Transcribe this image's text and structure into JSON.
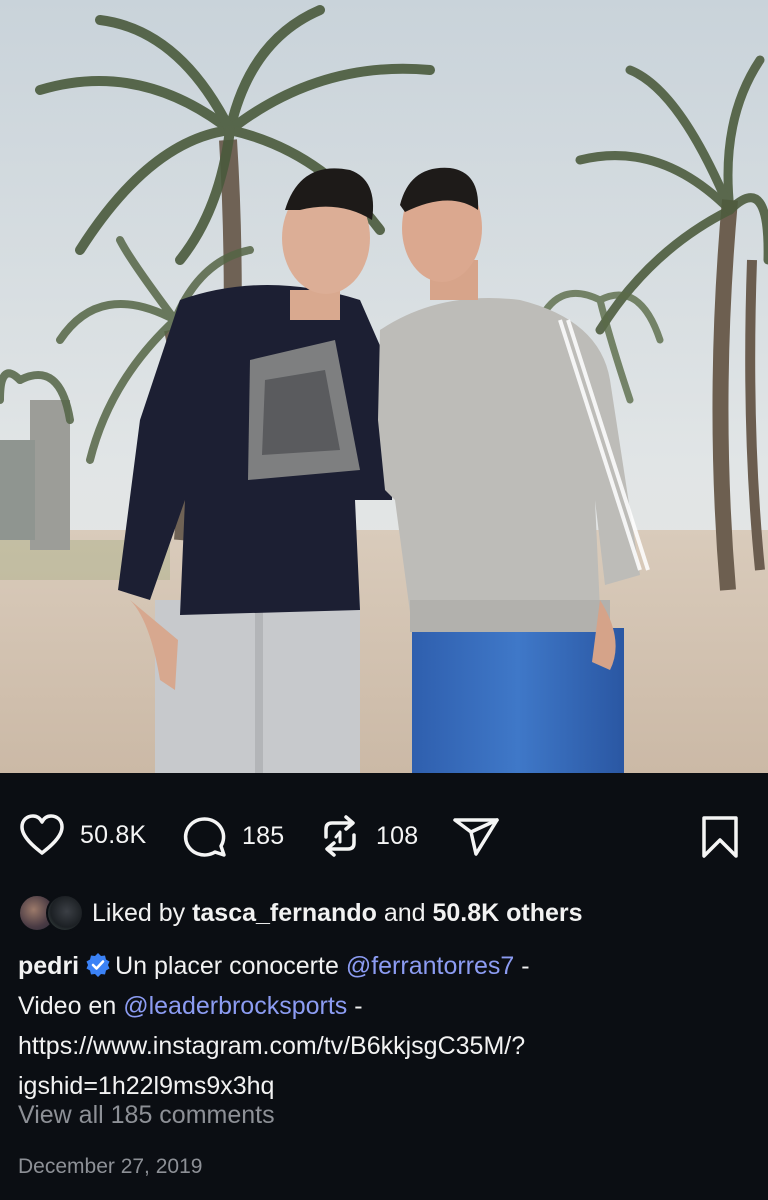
{
  "post": {
    "image_alt": "Two young men standing on a beach with palm trees"
  },
  "actions": {
    "likes_count": "50.8K",
    "comments_count": "185",
    "reposts_count": "108"
  },
  "liked_by": {
    "prefix": "Liked by",
    "user": "tasca_fernando",
    "middle": "and",
    "others": "50.8K others"
  },
  "caption": {
    "username": "pedri",
    "text_1": "Un placer conocerte",
    "mention_1": "@ferrantorres7",
    "text_2": "-",
    "text_3": "Video en",
    "mention_2": "@leaderbrocksports",
    "text_4": "-",
    "link_line_1": "https://www.instagram.com/tv/B6kkjsgC35M/?",
    "link_line_2": "igshid=1h22l9ms9x3hq"
  },
  "view_all_comments": "View all 185 comments",
  "date": "December 27, 2019",
  "colors": {
    "background": "#0b0e13",
    "mention": "#8c9cf2",
    "verified": "#3b82f6",
    "muted_text": "#8d9096"
  },
  "icons": [
    "heart-icon",
    "comment-icon",
    "repost-icon",
    "share-icon",
    "bookmark-icon",
    "verified-badge-icon"
  ]
}
